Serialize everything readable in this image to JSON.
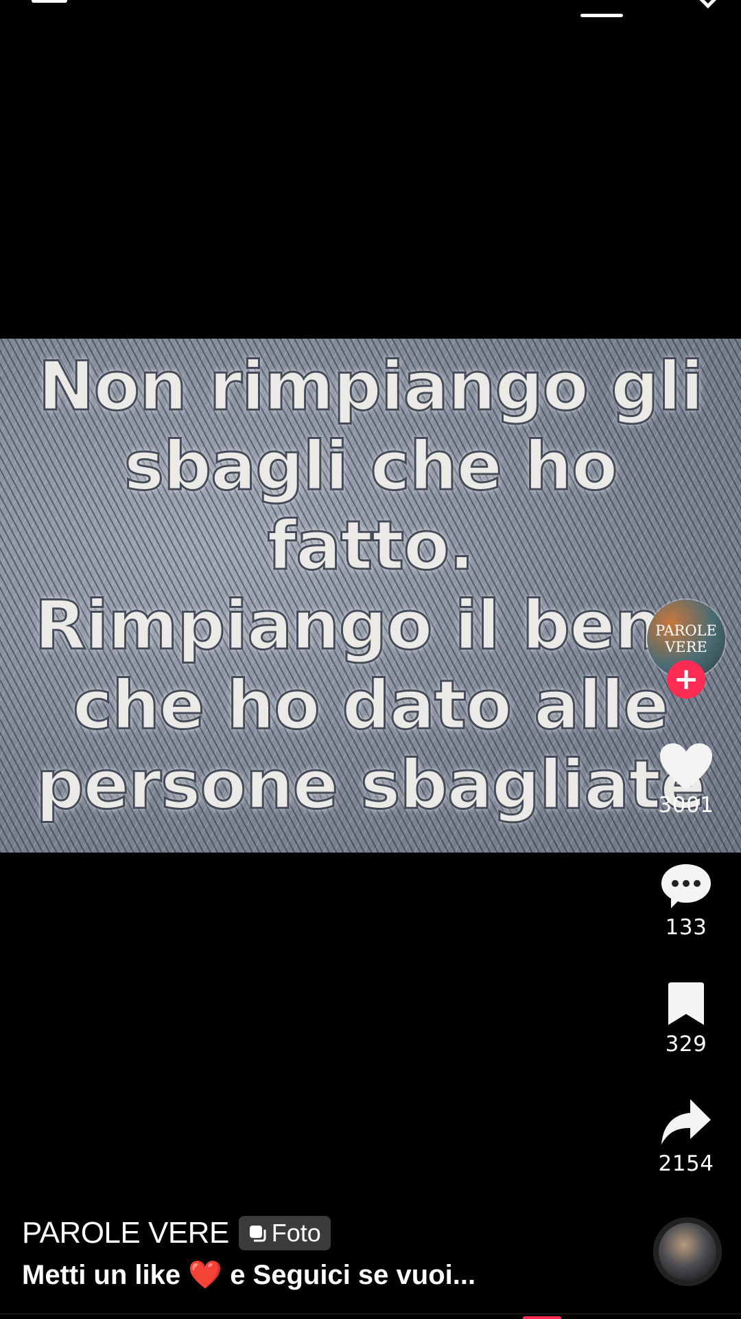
{
  "post": {
    "quote_lines": [
      "Non rimpiango gli",
      "sbagli che ho",
      "fatto.",
      "Rimpiango il bene",
      "che ho dato alle",
      "persone sbagliate"
    ]
  },
  "rail": {
    "avatar_text_1": "PAROLE",
    "avatar_text_2": "VERE",
    "follow_symbol": "+",
    "likes": "3001",
    "comments": "133",
    "saves": "329",
    "shares": "2154"
  },
  "info": {
    "author": "PAROLE VERE",
    "badge_label": "Foto",
    "caption_pre": "Metti un like",
    "caption_emoji": "❤️",
    "caption_post": " e Seguici se vuoi..."
  },
  "colors": {
    "accent": "#fe2c55",
    "background": "#000000"
  },
  "icons": [
    "heart-icon",
    "comment-icon",
    "bookmark-icon",
    "share-icon",
    "photo-icon",
    "plus-icon"
  ]
}
